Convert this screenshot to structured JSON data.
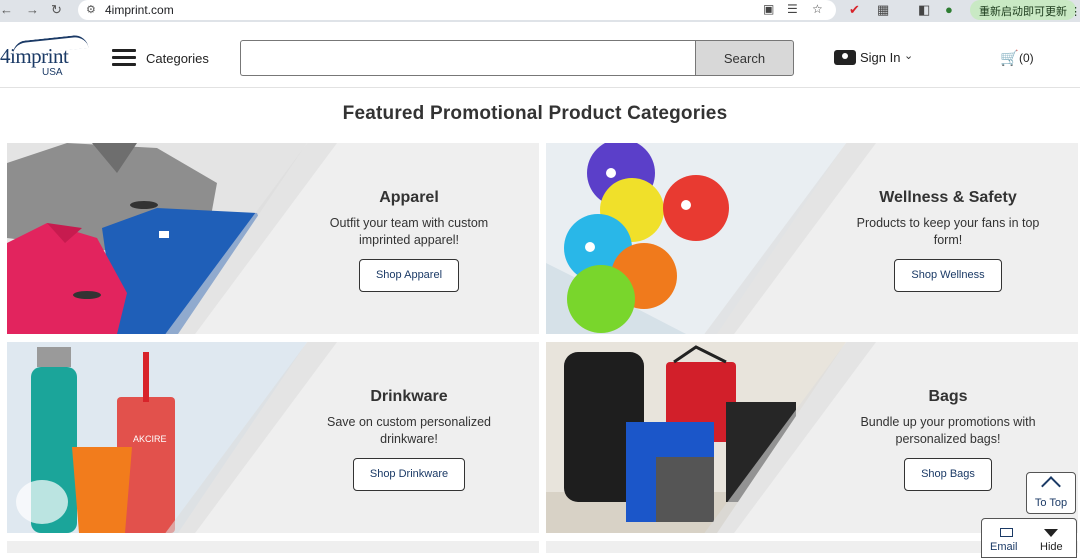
{
  "browser": {
    "url": "4imprint.com",
    "restart_label": "重新启动即可更新"
  },
  "header": {
    "logo_text": "4imprint",
    "logo_country": "USA",
    "categories_label": "Categories",
    "search_placeholder": "",
    "search_button": "Search",
    "sign_in_label": "Sign In",
    "cart_count": "(0)"
  },
  "main": {
    "title": "Featured Promotional Product Categories",
    "categories": [
      {
        "title": "Apparel",
        "description": "Outfit your team with custom imprinted apparel!",
        "button": "Shop Apparel"
      },
      {
        "title": "Wellness & Safety",
        "description": "Products to keep your fans in top form!",
        "button": "Shop Wellness"
      },
      {
        "title": "Drinkware",
        "description": "Save on custom personalized drinkware!",
        "button": "Shop Drinkware"
      },
      {
        "title": "Bags",
        "description": "Bundle up your promotions with personalized bags!",
        "button": "Shop Bags"
      }
    ]
  },
  "widgets": {
    "to_top": "To Top",
    "email": "Email",
    "hide": "Hide"
  },
  "colors": {
    "brand_navy": "#1b3a66",
    "card_bg": "#efefef"
  }
}
